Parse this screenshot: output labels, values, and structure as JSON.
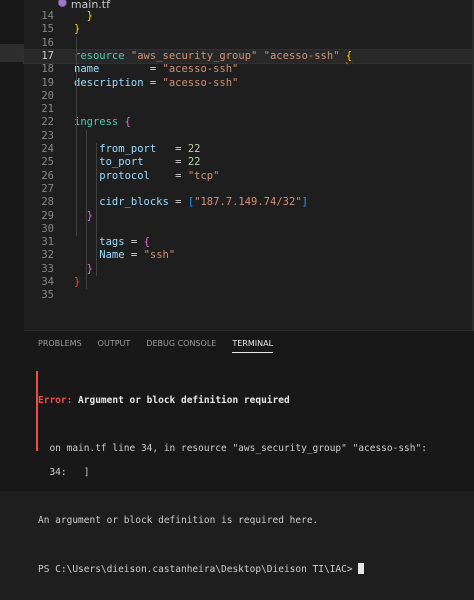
{
  "window": {
    "tab_label": "main.tf",
    "tab_icon": "terraform-file-icon"
  },
  "editor": {
    "lines": [
      {
        "n": "14",
        "parts": [
          {
            "c": "b1",
            "t": "  }"
          }
        ]
      },
      {
        "n": "15",
        "parts": [
          {
            "c": "b1",
            "t": "}"
          }
        ]
      },
      {
        "n": "16",
        "parts": []
      },
      {
        "n": "17",
        "active": true,
        "parts": [
          {
            "c": "kw",
            "t": "resource "
          },
          {
            "c": "str",
            "t": "\"aws_security_group\" \"acesso-ssh\" "
          },
          {
            "c": "b1 err-squiggle",
            "t": "{"
          }
        ]
      },
      {
        "n": "18",
        "parts": [
          {
            "c": "key",
            "t": "name        "
          },
          {
            "c": "eq",
            "t": "= "
          },
          {
            "c": "str",
            "t": "\"acesso-ssh\""
          }
        ]
      },
      {
        "n": "19",
        "parts": [
          {
            "c": "key",
            "t": "description "
          },
          {
            "c": "eq",
            "t": "= "
          },
          {
            "c": "str",
            "t": "\"acesso-ssh\""
          }
        ]
      },
      {
        "n": "20",
        "parts": []
      },
      {
        "n": "21",
        "parts": []
      },
      {
        "n": "22",
        "parts": [
          {
            "c": "kw",
            "t": "ingress "
          },
          {
            "c": "b2",
            "t": "{"
          }
        ]
      },
      {
        "n": "23",
        "parts": []
      },
      {
        "n": "24",
        "parts": [
          {
            "c": "key",
            "t": "    from_port   "
          },
          {
            "c": "eq",
            "t": "= "
          },
          {
            "c": "num",
            "t": "22"
          }
        ]
      },
      {
        "n": "25",
        "parts": [
          {
            "c": "key",
            "t": "    to_port     "
          },
          {
            "c": "eq",
            "t": "= "
          },
          {
            "c": "num",
            "t": "22"
          }
        ]
      },
      {
        "n": "26",
        "parts": [
          {
            "c": "key",
            "t": "    protocol    "
          },
          {
            "c": "eq",
            "t": "= "
          },
          {
            "c": "str",
            "t": "\"tcp\""
          }
        ]
      },
      {
        "n": "27",
        "parts": []
      },
      {
        "n": "28",
        "parts": [
          {
            "c": "key",
            "t": "    cidr_blocks "
          },
          {
            "c": "eq",
            "t": "= "
          },
          {
            "c": "b3",
            "t": "["
          },
          {
            "c": "str",
            "t": "\"187.7.149.74/32\""
          },
          {
            "c": "b3",
            "t": "]"
          }
        ]
      },
      {
        "n": "29",
        "parts": [
          {
            "c": "b2",
            "t": "  }"
          }
        ]
      },
      {
        "n": "30",
        "parts": []
      },
      {
        "n": "31",
        "parts": [
          {
            "c": "key",
            "t": "    tags "
          },
          {
            "c": "eq",
            "t": "= "
          },
          {
            "c": "b2",
            "t": "{"
          }
        ]
      },
      {
        "n": "32",
        "parts": [
          {
            "c": "key",
            "t": "    Name "
          },
          {
            "c": "eq",
            "t": "= "
          },
          {
            "c": "str",
            "t": "\"ssh\""
          }
        ]
      },
      {
        "n": "33",
        "parts": [
          {
            "c": "b2",
            "t": "  }"
          }
        ]
      },
      {
        "n": "34",
        "parts": [
          {
            "c": "br",
            "t": "}"
          }
        ]
      },
      {
        "n": "35",
        "parts": []
      }
    ]
  },
  "panel": {
    "tabs": [
      "PROBLEMS",
      "OUTPUT",
      "DEBUG CONSOLE",
      "TERMINAL"
    ],
    "active_tab": "TERMINAL",
    "terminal": {
      "error_label": "Error:",
      "error_title": " Argument or block definition required",
      "location": "  on main.tf line 34, in resource \"aws_security_group\" \"acesso-ssh\":",
      "source_line": "  34:   ]",
      "detail": "An argument or block definition is required here.",
      "prompt": "PS C:\\Users\\dieison.castanheira\\Desktop\\Dieison TI\\IAC> "
    }
  },
  "colors": {
    "error": "#f14c4c",
    "keyword": "#4ec9b0",
    "string": "#ce9178",
    "number": "#b5cea8"
  }
}
